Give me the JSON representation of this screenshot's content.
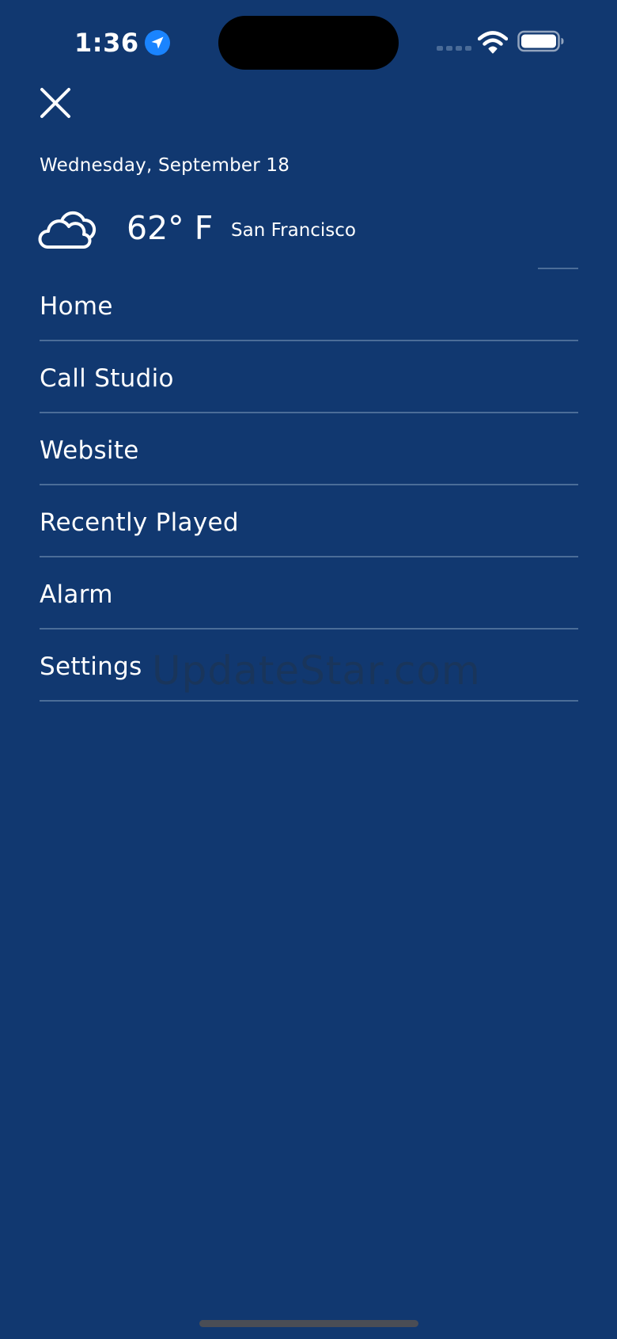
{
  "status_bar": {
    "time": "1:36",
    "location_icon": "location-arrow-icon",
    "signal_icon": "cellular-signal-icon",
    "wifi_icon": "wifi-icon",
    "battery_icon": "battery-icon"
  },
  "header": {
    "close_icon": "close-icon",
    "date": "Wednesday, September 18"
  },
  "weather": {
    "icon": "cloud-icon",
    "temperature": "62° F",
    "city": "San Francisco"
  },
  "menu": {
    "items": [
      {
        "label": "Home"
      },
      {
        "label": "Call Studio"
      },
      {
        "label": "Website"
      },
      {
        "label": "Recently Played"
      },
      {
        "label": "Alarm"
      },
      {
        "label": "Settings"
      }
    ]
  },
  "watermark": "UpdateStar.com",
  "colors": {
    "background": "#113870",
    "divider": "#4b6d98",
    "text": "#ffffff",
    "location_badge": "#1a84ff"
  }
}
